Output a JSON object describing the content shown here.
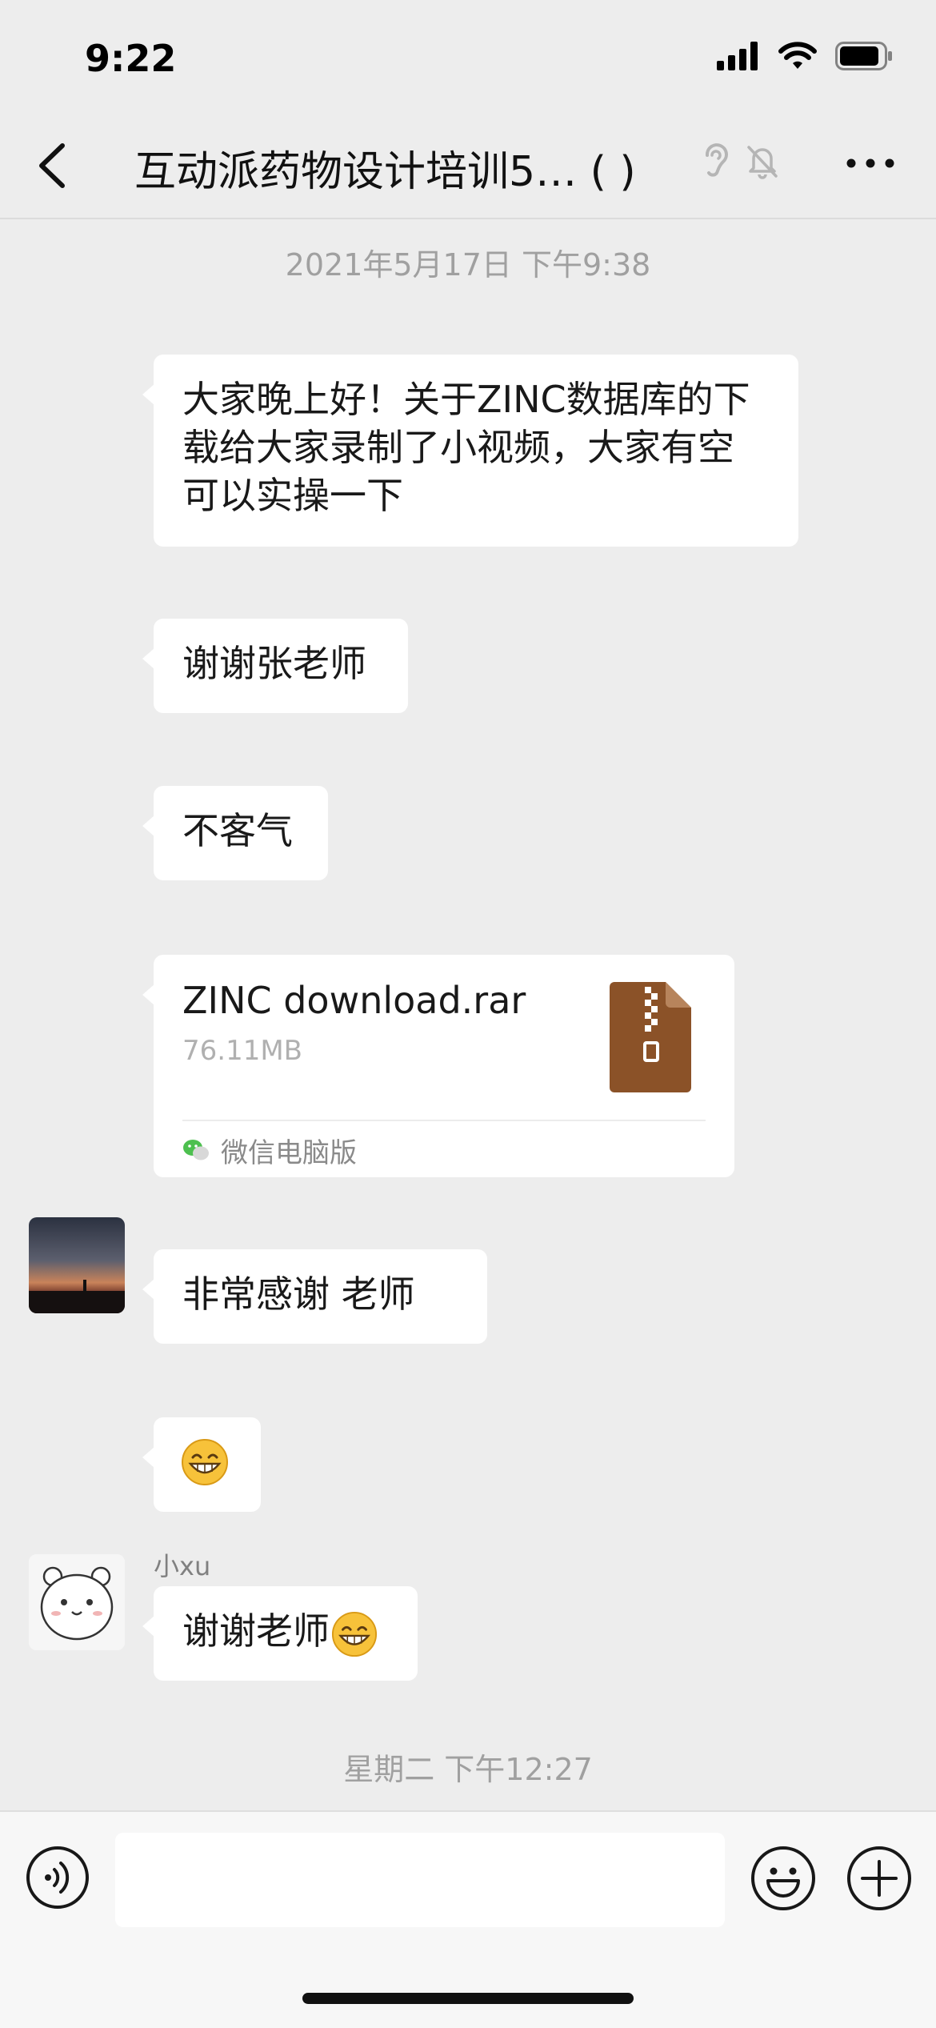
{
  "status_bar": {
    "time": "9:22"
  },
  "nav": {
    "title": "互动派药物设计培训5…  (     )"
  },
  "timestamps": [
    "2021年5月17日 下午9:38",
    "星期二 下午12:27"
  ],
  "messages": [
    {
      "text": "大家晚上好！关于ZINC数据库的下载给大家录制了小视频，大家有空可以实操一下"
    },
    {
      "text": "谢谢张老师"
    },
    {
      "text": "不客气"
    },
    {
      "file": {
        "name": "ZINC download.rar",
        "size": "76.11MB",
        "source": "微信电脑版"
      }
    },
    {
      "text": "非常感谢     老师"
    },
    {
      "emoji": "grinning-face"
    },
    {
      "sender": "小xu",
      "text": "谢谢老师"
    }
  ],
  "colors": {
    "background": "#ededed",
    "bubble": "#ffffff",
    "file_icon": "#8b5228"
  },
  "icons": [
    "back-icon",
    "ear-icon",
    "mute-bell-icon",
    "more-icon",
    "voice-icon",
    "emoji-icon",
    "plus-icon",
    "zip-file-icon",
    "wechat-icon"
  ]
}
